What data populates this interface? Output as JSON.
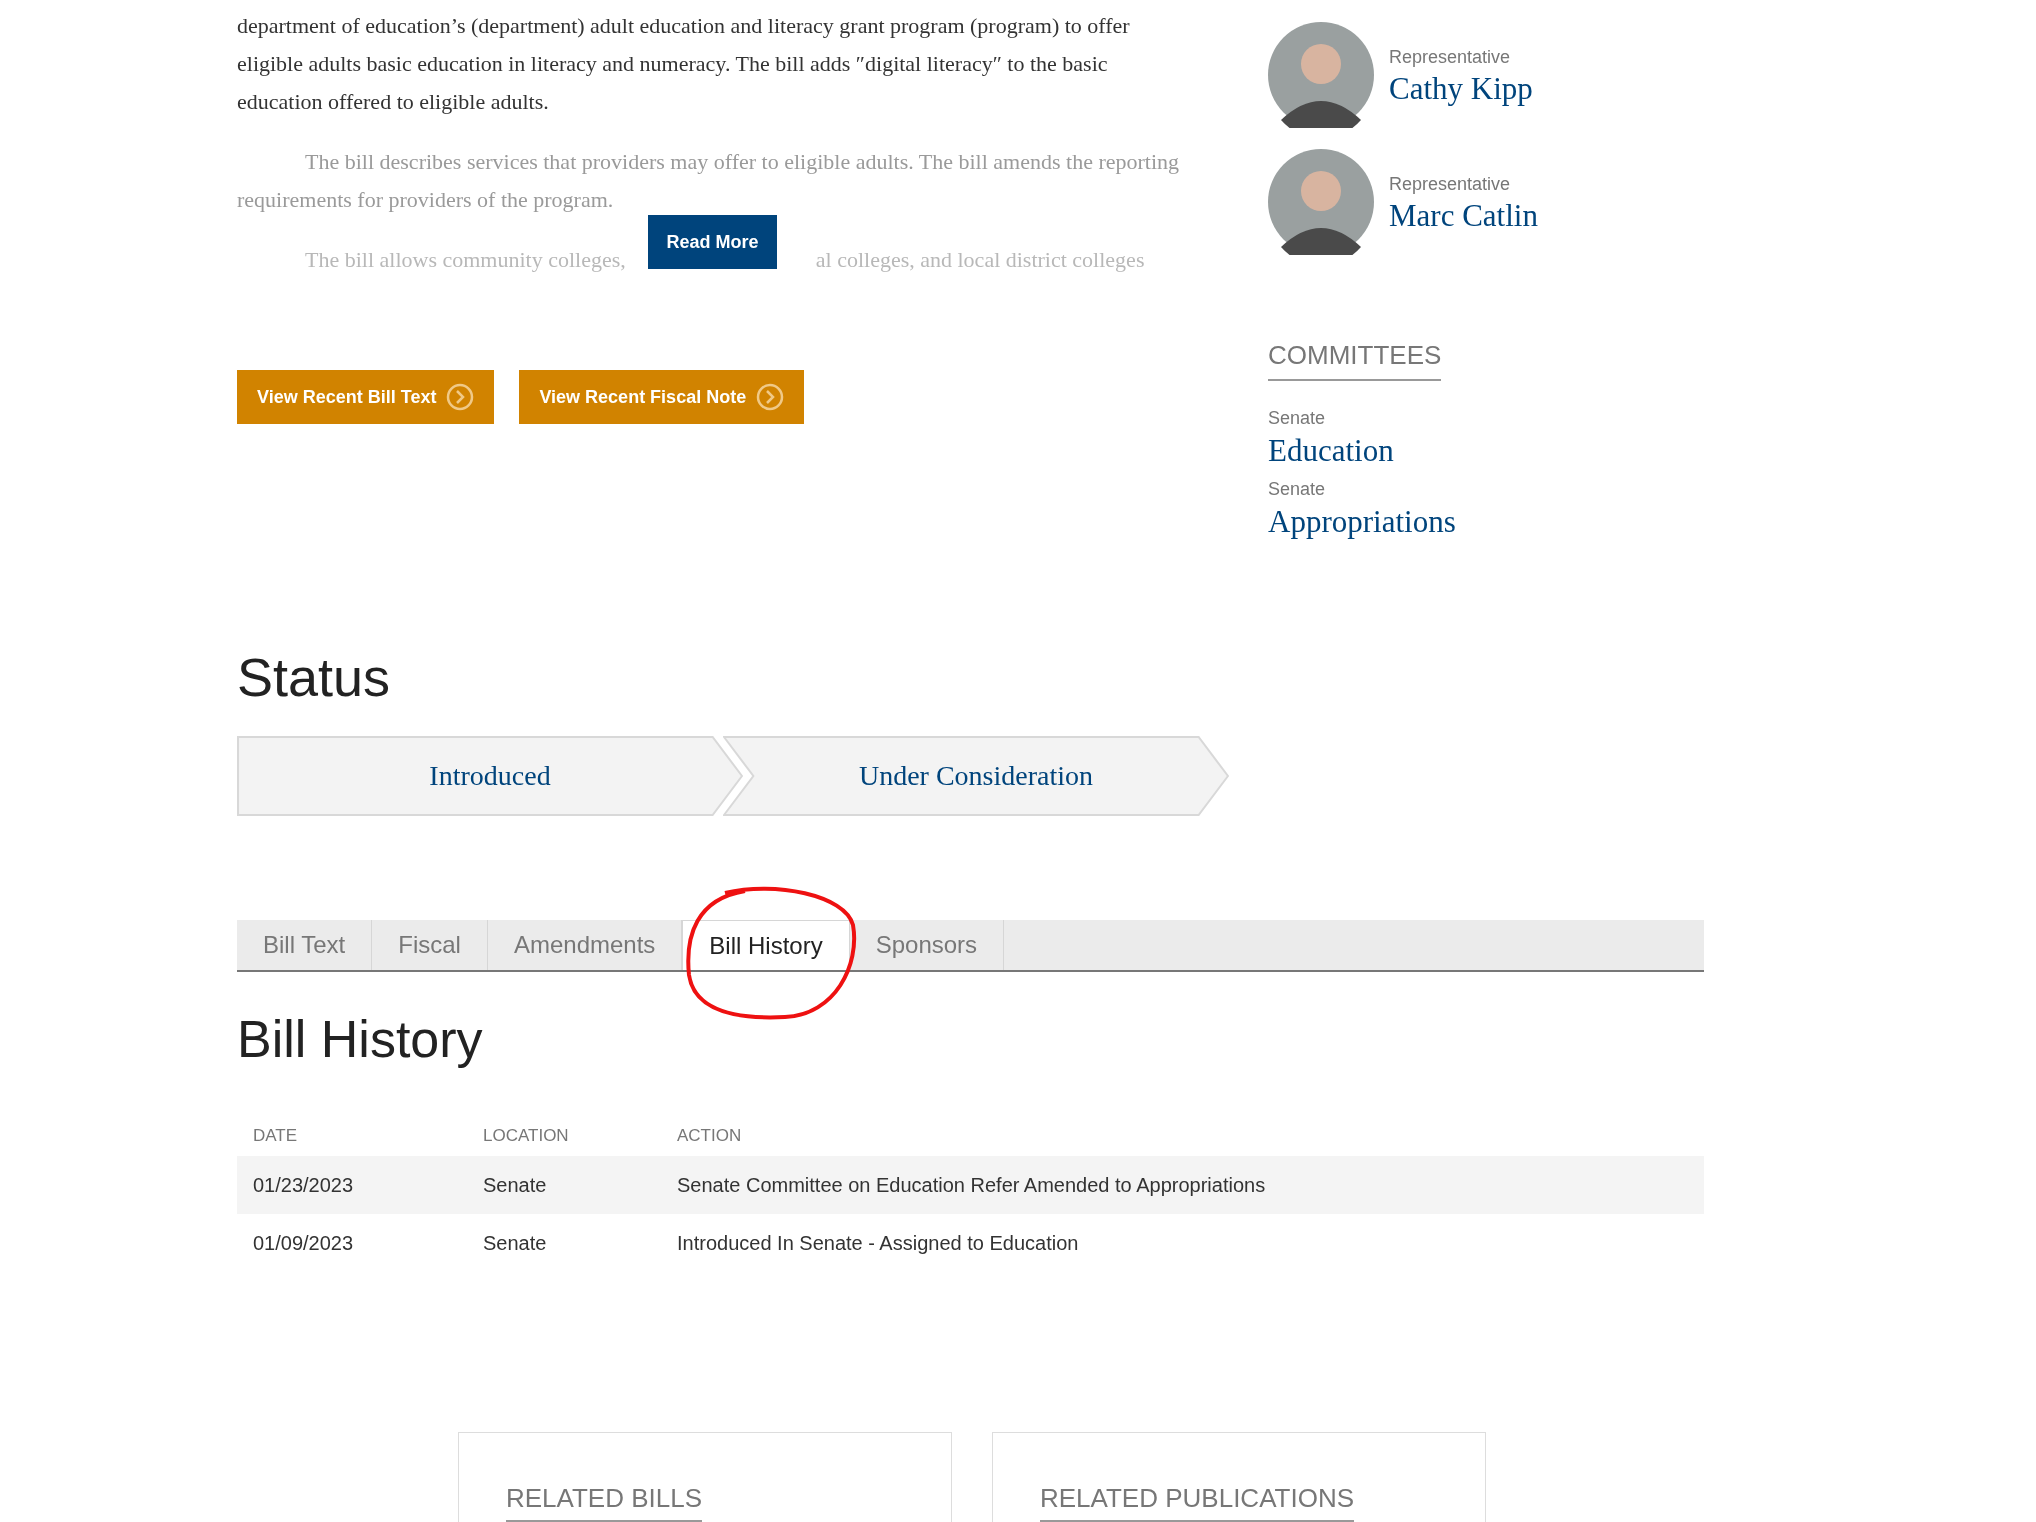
{
  "summary": {
    "paragraphs": [
      {
        "kind": "plain",
        "text": "department of education’s (department) adult education and literacy grant program (program) to offer eligible adults basic education in literacy and numeracy. The bill adds ″digital literacy″ to the basic education offered to eligible adults."
      },
      {
        "kind": "faded",
        "text": "The bill describes services that providers may offer to eligible adults. The bill amends the reporting requirements for providers of the program."
      },
      {
        "kind": "covered",
        "parts": [
          "The bill allows community colleges,",
          "al colleges, and local district colleges"
        ]
      }
    ],
    "read_more": "Read More",
    "buttons": [
      "View Recent Bill Text",
      "View Recent Fiscal Note"
    ]
  },
  "sponsors": [
    {
      "role": "Representative",
      "name": "Cathy Kipp"
    },
    {
      "role": "Representative",
      "name": "Marc Catlin"
    }
  ],
  "committees": {
    "title": "COMMITTEES",
    "items": [
      {
        "chamber": "Senate",
        "name": "Education"
      },
      {
        "chamber": "Senate",
        "name": "Appropriations"
      }
    ]
  },
  "status": {
    "title": "Status",
    "steps": [
      "Introduced",
      "Under Consideration"
    ]
  },
  "tabs": [
    {
      "label": "Bill Text",
      "selected": false
    },
    {
      "label": "Fiscal",
      "selected": false
    },
    {
      "label": "Amendments",
      "selected": false
    },
    {
      "label": "Bill History",
      "selected": true
    },
    {
      "label": "Sponsors",
      "selected": false
    }
  ],
  "history": {
    "title": "Bill History",
    "columns": [
      "DATE",
      "LOCATION",
      "ACTION"
    ],
    "rows": [
      [
        "01/23/2023",
        "Senate",
        "Senate Committee on Education Refer Amended to Appropriations"
      ],
      [
        "01/09/2023",
        "Senate",
        "Introduced In Senate - Assigned to Education"
      ]
    ]
  },
  "related": [
    "RELATED BILLS",
    "RELATED PUBLICATIONS"
  ]
}
